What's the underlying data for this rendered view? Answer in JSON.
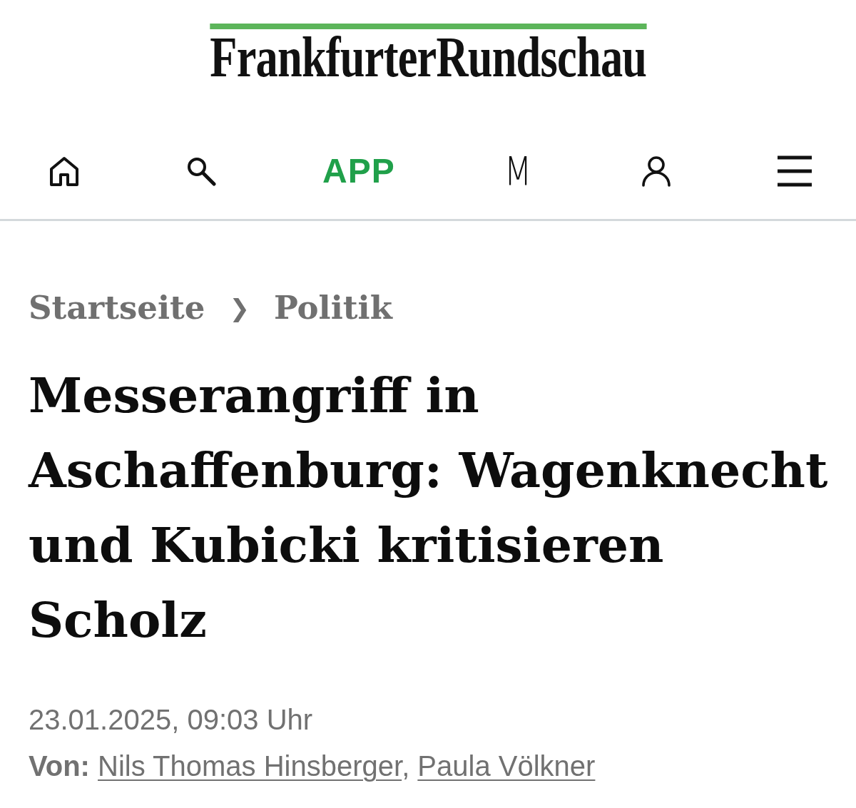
{
  "logo": {
    "text": "FrankfurterRundschau"
  },
  "nav": [
    {
      "kind": "home"
    },
    {
      "kind": "search"
    },
    {
      "kind": "app",
      "label": "APP"
    },
    {
      "kind": "glyph",
      "label": "M"
    },
    {
      "kind": "account"
    },
    {
      "kind": "menu"
    }
  ],
  "breadcrumb": {
    "items": [
      {
        "label": "Startseite"
      },
      {
        "label": "Politik"
      }
    ],
    "separator": "❯"
  },
  "article": {
    "headline": "Messerangriff in Aschaffenburg: Wagenknecht und Kubicki kritisieren Scholz",
    "date": "23.01.2025, 09:03 Uhr",
    "byline": {
      "label": "Von:",
      "authors": [
        "Nils Thomas Hinsberger",
        "Paula Völkner"
      ],
      "separator": ","
    }
  }
}
